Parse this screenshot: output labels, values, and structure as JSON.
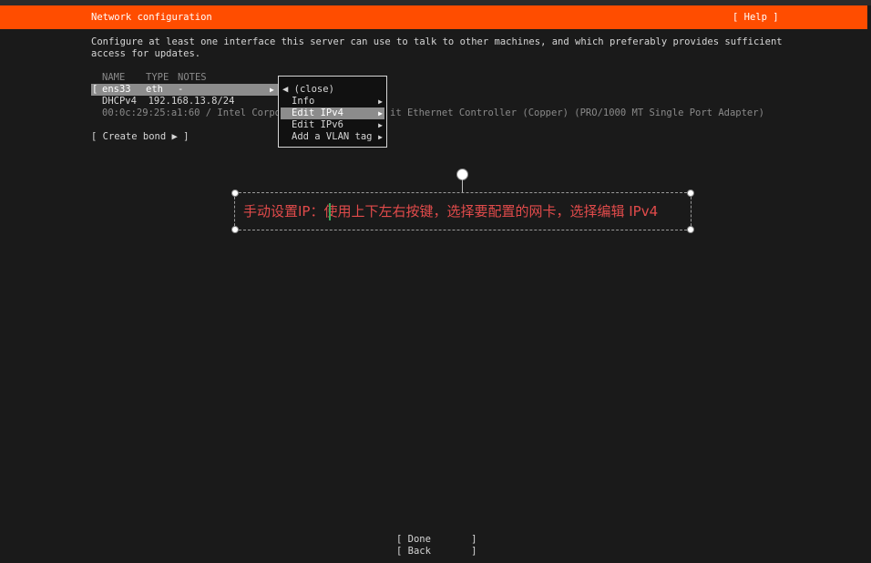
{
  "header": {
    "title": "Network configuration",
    "help": "[ Help ]"
  },
  "intro": "Configure at least one interface this server can use to talk to other machines, and which preferably provides sufficient access for updates.",
  "table": {
    "col_name": "NAME",
    "col_type": "TYPE",
    "col_notes": "NOTES",
    "row": {
      "bracket": "[",
      "name": "ens33",
      "type": "eth",
      "notes": "-",
      "arrow": "▶"
    },
    "dhcp": "DHCPv4  192.168.13.8/24",
    "hw_left": "00:0c:29:25:a1:60 / Intel Corpor",
    "hw_right": "it Ethernet Controller (Copper) (PRO/1000 MT Single Port Adapter)"
  },
  "create_bond": "[ Create bond ▶ ]",
  "menu": {
    "close": "◀ (close)",
    "items": [
      {
        "label": "Info",
        "arrow": "▶"
      },
      {
        "label": "Edit IPv4",
        "arrow": "▶"
      },
      {
        "label": "Edit IPv6",
        "arrow": "▶"
      },
      {
        "label": "Add a VLAN tag",
        "arrow": "▶"
      }
    ]
  },
  "annotation": {
    "text_a": "手动设置IP：",
    "text_b": "使用上下左右按键，选择要配置的网卡，选择编辑 IPv4",
    "color": "#e24b4b"
  },
  "buttons": {
    "done": "[ Done       ]",
    "back": "[ Back       ]"
  },
  "colors": {
    "header": "#ff4d00",
    "background": "#1a1a1a",
    "selection": "#8c8c8c"
  }
}
